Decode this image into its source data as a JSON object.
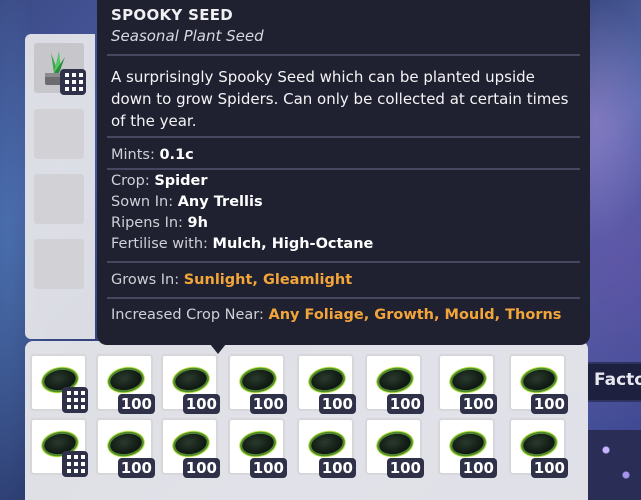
{
  "tooltip": {
    "title": "SPOOKY SEED",
    "subtitle": "Seasonal Plant Seed",
    "description": "A surprisingly Spooky Seed which can be planted upside down to grow Spiders. Can only be collected at certain times of the year.",
    "mints_label": "Mints:",
    "mints_value": "0.1c",
    "crop_label": "Crop:",
    "crop_value": "Spider",
    "sown_label": "Sown In:",
    "sown_value": "Any Trellis",
    "ripens_label": "Ripens In:",
    "ripens_value": "9h",
    "fertilise_label": "Fertilise with:",
    "fertilise_value": "Mulch, High-Octane",
    "grows_label": "Grows In:",
    "grows_value": "Sunlight, Gleamlight",
    "increased_label": "Increased Crop Near:",
    "increased_value": "Any Foliage, Growth, Mould, Thorns"
  },
  "background": {
    "sign_text": "Facto"
  },
  "inventory": {
    "row1": [
      "",
      "100",
      "100",
      "100",
      "100",
      "100",
      "100",
      "100"
    ],
    "row2": [
      "",
      "100",
      "100",
      "100",
      "100",
      "100",
      "100",
      "100"
    ]
  },
  "colors": {
    "highlight": "#f4a53a",
    "tooltip_bg": "#1f2130"
  }
}
